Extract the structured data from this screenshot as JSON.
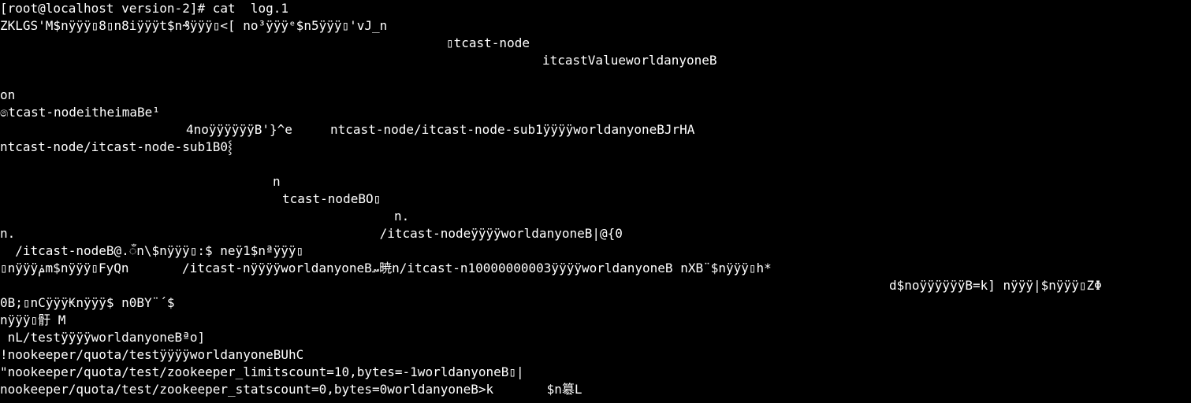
{
  "terminal": {
    "background": "#000000",
    "foreground": "#ffffff",
    "prompt_line": "[root@localhost version-2]# cat  log.1",
    "output_lines": [
      {
        "text": "ZKLGS'M$nÿÿÿ▯8▯n8iÿÿÿt$n₰ÿÿÿ▯<[ no³ÿÿÿᵉ$n5ÿÿÿ▯'vJ_n"
      },
      {
        "text": "▯tcast-node"
      },
      {
        "text": "itcastValueworldanyoneB"
      },
      {
        "text": ""
      },
      {
        "text": "on"
      },
      {
        "text": "෧tcast-nodeitheimaBe¹"
      },
      {
        "text": "4noÿÿÿÿÿÿB'}^e     ntcast-node/itcast-node-sub1ÿÿÿÿworldanyoneBJrHA"
      },
      {
        "text": "ntcast-node/itcast-node-sub1B0⸾"
      },
      {
        "text": ""
      },
      {
        "text": "n"
      },
      {
        "text": "tcast-nodeBO▯"
      },
      {
        "text": "n."
      },
      {
        "text": "n.                                                /itcast-nodeÿÿÿÿworldanyoneB|@{0"
      },
      {
        "text": "  /itcast-nodeB@.ँn\\$nÿÿÿ▯:$ neÿ1$nªÿÿÿ▯"
      },
      {
        "text": "▯nÿÿÿݥm$nÿÿÿ▯FyQn       /itcast-nÿÿÿÿworldanyoneB؄暁n/itcast-n10000000003ÿÿÿÿworldanyoneB nXB¨$nÿÿÿ▯h*"
      },
      {
        "text": "d$noÿÿÿÿÿÿB=k] nÿÿÿ|$nÿÿÿ▯ZΦ"
      },
      {
        "text": "0B;▯nCÿÿÿ₭nÿÿÿ$ n0BY¨´$"
      },
      {
        "text": "nÿÿÿ▯骬 M"
      },
      {
        "text": " nL/testÿÿÿÿworldanyoneBªo]"
      },
      {
        "text": "!nookeeper/quota/testÿÿÿÿworldanyoneBUhC"
      },
      {
        "text": "\"nookeeper/quota/test/zookeeper_limitscount=10,bytes=-1worldanyoneB▯|"
      },
      {
        "text": "nookeeper/quota/test/zookeeper_statscount=0,bytes=0worldanyoneB>k       $n簒L"
      }
    ]
  }
}
